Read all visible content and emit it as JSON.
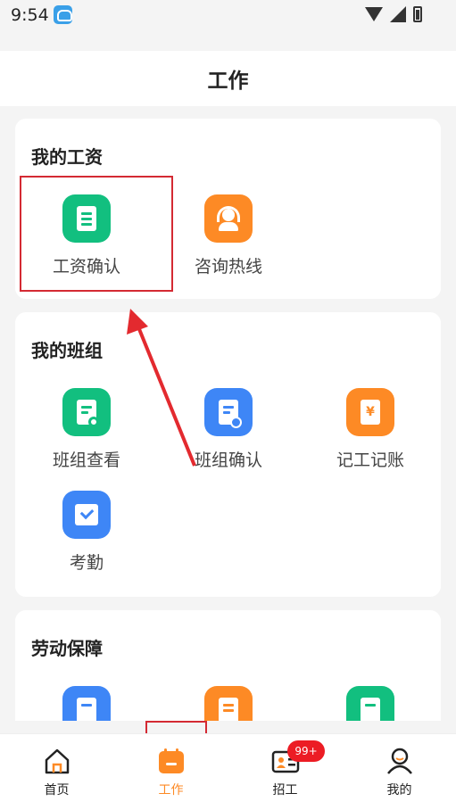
{
  "status_bar": {
    "time": "9:54"
  },
  "header": {
    "title": "工作"
  },
  "sections": [
    {
      "title": "我的工资",
      "items": [
        {
          "label": "工资确认"
        },
        {
          "label": "咨询热线"
        }
      ]
    },
    {
      "title": "我的班组",
      "items": [
        {
          "label": "班组查看"
        },
        {
          "label": "班组确认"
        },
        {
          "label": "记工记账"
        },
        {
          "label": "考勤"
        }
      ]
    },
    {
      "title": "劳动保障",
      "items": []
    }
  ],
  "bottom_nav": [
    {
      "label": "首页"
    },
    {
      "label": "工作"
    },
    {
      "label": "招工"
    },
    {
      "label": "我的"
    }
  ],
  "badge": "99+",
  "colors": {
    "accent": "#fd8a25",
    "green": "#12bf7f",
    "blue": "#3e86f6",
    "highlight": "#d42a33"
  },
  "icons": [
    "document-list-icon",
    "headset-icon",
    "team-search-icon",
    "team-check-icon",
    "ledger-yen-icon",
    "calendar-check-icon",
    "home-icon",
    "work-calendar-icon",
    "recruit-card-icon",
    "profile-icon"
  ]
}
